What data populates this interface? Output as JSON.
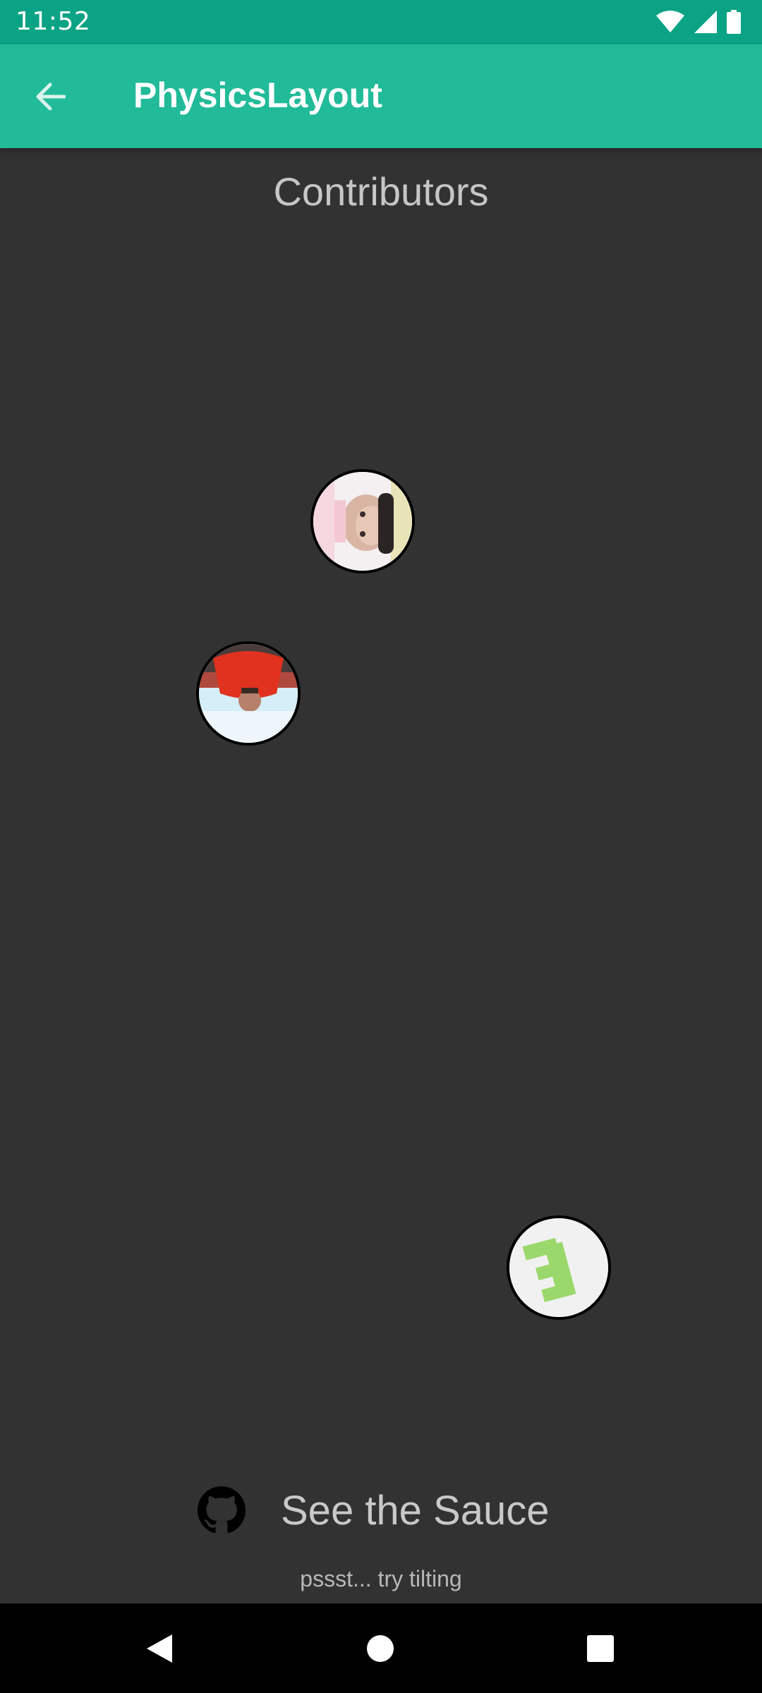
{
  "status_bar": {
    "time": "11:52",
    "icons": [
      "wifi-icon",
      "cellular-signal-icon",
      "battery-icon"
    ]
  },
  "app_bar": {
    "title": "PhysicsLayout",
    "back_icon": "arrow-back-icon"
  },
  "content": {
    "contributors_title": "Contributors",
    "avatars": [
      "contributor-avatar-1",
      "contributor-avatar-2",
      "contributor-avatar-3"
    ],
    "see_sauce_label": "See the Sauce",
    "hint": "pssst... try tilting"
  },
  "colors": {
    "status_bar": "#0aa385",
    "app_bar": "#22bb99",
    "background": "#323232",
    "nav_bar": "#000000"
  },
  "nav_bar": {
    "icons": [
      "nav-back-icon",
      "nav-home-icon",
      "nav-recents-icon"
    ]
  }
}
